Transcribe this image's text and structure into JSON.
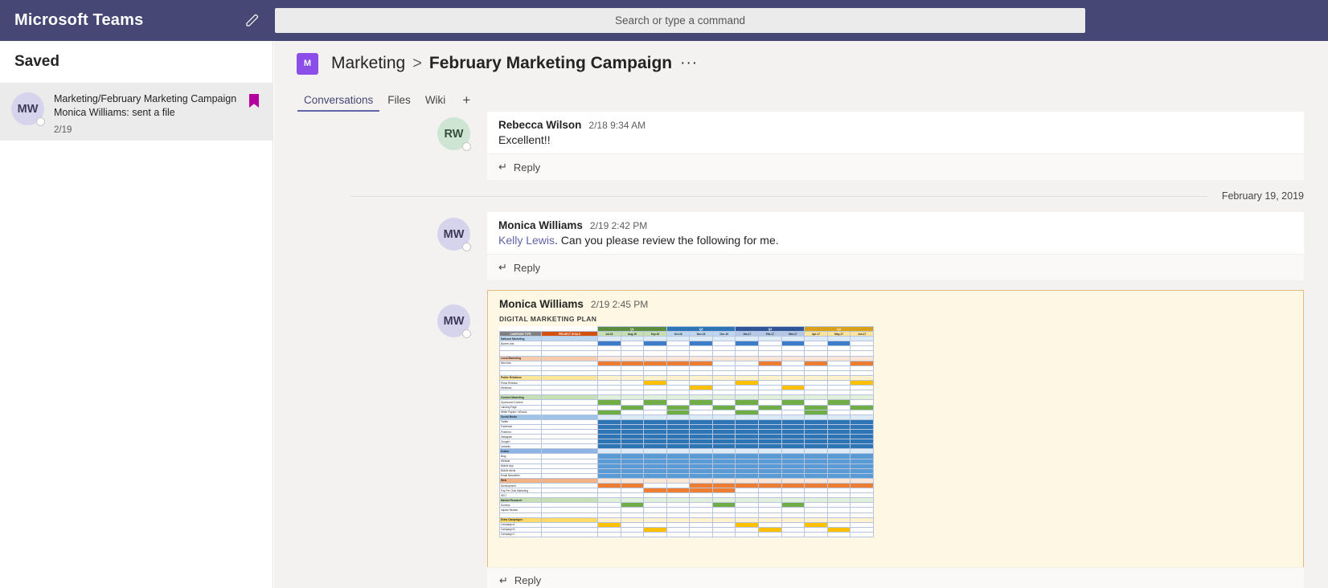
{
  "app": {
    "title": "Microsoft Teams",
    "compose_icon": "compose-icon",
    "search_placeholder": "Search or type a command",
    "accent": "#464775",
    "brand_purple": "#6264a7"
  },
  "sidebar": {
    "header": "Saved",
    "items": [
      {
        "avatar_initials": "MW",
        "line1": "Marketing/February Marketing Campaign",
        "line2": "Monica Williams: sent a file",
        "date": "2/19",
        "bookmark_icon": "bookmark-icon",
        "bookmark_color": "#b4009e"
      }
    ]
  },
  "channel": {
    "badge_initial": "M",
    "team": "Marketing",
    "separator": ">",
    "name": "February Marketing Campaign",
    "more": "···",
    "tabs": [
      {
        "label": "Conversations",
        "active": true
      },
      {
        "label": "Files",
        "active": false
      },
      {
        "label": "Wiki",
        "active": false
      }
    ],
    "add_tab": "+"
  },
  "conversation": {
    "reply_label": "Reply",
    "reply_icon": "reply-arrow-icon",
    "day_separator": "February 19, 2019",
    "messages": [
      {
        "avatar_initials": "RW",
        "author": "Rebecca Wilson",
        "time": "2/18 9:34 AM",
        "text": "Excellent!!"
      },
      {
        "avatar_initials": "MW",
        "author": "Monica Williams",
        "time": "2/19 2:42 PM",
        "mention": "Kelly Lewis",
        "text": ". Can you please review the following for me."
      },
      {
        "avatar_initials": "MW",
        "author": "Monica Williams",
        "time": "2/19 2:45 PM",
        "attachment_title": "DIGITAL MARKETING PLAN"
      }
    ]
  },
  "chart_data": {
    "type": "table",
    "title": "DIGITAL MARKETING PLAN",
    "columns": [
      "CAMPAIGN TYPE",
      "PROJECT GOALS"
    ],
    "quarters": [
      {
        "label": "Q1",
        "color": "#5b8c3e",
        "months": [
          "Jul-16",
          "Aug-16",
          "Sep-16"
        ]
      },
      {
        "label": "Q2",
        "color": "#2e75b6",
        "months": [
          "Oct-16",
          "Nov-16",
          "Dec-16"
        ]
      },
      {
        "label": "Q3",
        "color": "#2f5597",
        "months": [
          "Jan-17",
          "Feb-17",
          "Mar-17"
        ]
      },
      {
        "label": "Q4",
        "color": "#d9a01a",
        "months": [
          "Apr-17",
          "May-17",
          "Jun-17"
        ]
      }
    ],
    "sections": [
      {
        "name": "National Marketing",
        "style": "sec-blue",
        "tint": "tint-blue",
        "rows": [
          {
            "label": "Banner Ads",
            "fill": "f-blue",
            "cells": [
              1,
              0,
              1,
              0,
              1,
              0,
              1,
              0,
              1,
              0,
              1,
              0
            ]
          },
          {
            "label": "",
            "fill": "f-none",
            "cells": [
              0,
              0,
              0,
              0,
              0,
              0,
              0,
              0,
              0,
              0,
              0,
              0
            ]
          },
          {
            "label": "",
            "fill": "f-none",
            "cells": [
              0,
              0,
              0,
              0,
              0,
              0,
              0,
              0,
              0,
              0,
              0,
              0
            ]
          }
        ]
      },
      {
        "name": "Local Marketing",
        "style": "sec-peach",
        "tint": "tint-peach",
        "rows": [
          {
            "label": "New Ads",
            "fill": "f-orange",
            "cells": [
              1,
              1,
              1,
              1,
              1,
              0,
              0,
              1,
              0,
              1,
              0,
              1
            ]
          },
          {
            "label": "",
            "fill": "f-none",
            "cells": [
              0,
              0,
              0,
              0,
              0,
              0,
              0,
              0,
              0,
              0,
              0,
              0
            ]
          },
          {
            "label": "",
            "fill": "f-none",
            "cells": [
              0,
              0,
              0,
              0,
              0,
              0,
              0,
              0,
              0,
              0,
              0,
              0
            ]
          }
        ]
      },
      {
        "name": "Public Relations",
        "style": "sec-yellow",
        "tint": "tint-yellow",
        "rows": [
          {
            "label": "Press Release",
            "fill": "f-gold",
            "cells": [
              0,
              0,
              1,
              0,
              0,
              0,
              1,
              0,
              0,
              0,
              0,
              1
            ]
          },
          {
            "label": "Webinars",
            "fill": "f-gold",
            "cells": [
              0,
              0,
              0,
              0,
              1,
              0,
              0,
              0,
              1,
              0,
              0,
              0
            ]
          },
          {
            "label": "",
            "fill": "f-none",
            "cells": [
              0,
              0,
              0,
              0,
              0,
              0,
              0,
              0,
              0,
              0,
              0,
              0
            ]
          }
        ]
      },
      {
        "name": "Content Marketing",
        "style": "sec-green",
        "tint": "tint-green",
        "rows": [
          {
            "label": "Sponsored Content",
            "fill": "f-green",
            "cells": [
              1,
              0,
              1,
              0,
              1,
              0,
              1,
              0,
              1,
              0,
              1,
              0
            ]
          },
          {
            "label": "Landing Page",
            "fill": "f-green",
            "cells": [
              0,
              1,
              0,
              1,
              0,
              1,
              0,
              1,
              0,
              1,
              0,
              1
            ]
          },
          {
            "label": "White Papers / eBooks",
            "fill": "f-green",
            "cells": [
              1,
              0,
              0,
              1,
              0,
              0,
              1,
              0,
              0,
              1,
              0,
              0
            ]
          }
        ]
      },
      {
        "name": "Social Media",
        "style": "sec-blue2",
        "tint": "tint-blue",
        "rows": [
          {
            "label": "Twitter",
            "fill": "f-dkblue",
            "cells": [
              1,
              1,
              1,
              1,
              1,
              1,
              1,
              1,
              1,
              1,
              1,
              1
            ]
          },
          {
            "label": "Facebook",
            "fill": "f-dkblue",
            "cells": [
              1,
              1,
              1,
              1,
              1,
              1,
              1,
              1,
              1,
              1,
              1,
              1
            ]
          },
          {
            "label": "Pinterest",
            "fill": "f-dkblue",
            "cells": [
              1,
              1,
              1,
              1,
              1,
              1,
              1,
              1,
              1,
              1,
              1,
              1
            ]
          },
          {
            "label": "Instagram",
            "fill": "f-dkblue",
            "cells": [
              1,
              1,
              1,
              1,
              1,
              1,
              1,
              1,
              1,
              1,
              1,
              1
            ]
          },
          {
            "label": "Google+",
            "fill": "f-dkblue",
            "cells": [
              1,
              1,
              1,
              1,
              1,
              1,
              1,
              1,
              1,
              1,
              1,
              1
            ]
          },
          {
            "label": "LinkedIn",
            "fill": "f-dkblue",
            "cells": [
              1,
              1,
              1,
              1,
              1,
              1,
              1,
              1,
              1,
              1,
              1,
              1
            ]
          }
        ]
      },
      {
        "name": "Online",
        "style": "sec-dkblue",
        "tint": "tint-blue",
        "rows": [
          {
            "label": "Blog",
            "fill": "f-ltblue",
            "cells": [
              1,
              1,
              1,
              1,
              1,
              1,
              1,
              1,
              1,
              1,
              1,
              1
            ]
          },
          {
            "label": "Website",
            "fill": "f-ltblue",
            "cells": [
              1,
              1,
              1,
              1,
              1,
              1,
              1,
              1,
              1,
              1,
              1,
              1
            ]
          },
          {
            "label": "Mobile App",
            "fill": "f-ltblue",
            "cells": [
              1,
              1,
              1,
              1,
              1,
              1,
              1,
              1,
              1,
              1,
              1,
              1
            ]
          },
          {
            "label": "Mobile Alerts",
            "fill": "f-ltblue",
            "cells": [
              1,
              1,
              1,
              1,
              1,
              1,
              1,
              1,
              1,
              1,
              1,
              1
            ]
          },
          {
            "label": "Email Newsletter",
            "fill": "f-ltblue",
            "cells": [
              1,
              1,
              1,
              1,
              1,
              1,
              1,
              1,
              1,
              1,
              1,
              1
            ]
          }
        ]
      },
      {
        "name": "Web",
        "style": "sec-orange",
        "tint": "tint-peach",
        "rows": [
          {
            "label": "Development",
            "fill": "f-orange",
            "cells": [
              1,
              1,
              0,
              0,
              1,
              1,
              1,
              1,
              1,
              1,
              1,
              1
            ]
          },
          {
            "label": "Pay Per Click Marketing",
            "fill": "f-orange",
            "cells": [
              0,
              0,
              1,
              1,
              1,
              1,
              0,
              0,
              0,
              0,
              0,
              0
            ]
          },
          {
            "label": "SEO",
            "fill": "f-orange",
            "cells": [
              0,
              0,
              0,
              0,
              0,
              0,
              0,
              0,
              0,
              0,
              0,
              0
            ]
          }
        ]
      },
      {
        "name": "Market Research",
        "style": "sec-green2",
        "tint": "tint-green",
        "rows": [
          {
            "label": "Surveys",
            "fill": "f-green",
            "cells": [
              0,
              1,
              0,
              0,
              0,
              1,
              0,
              0,
              1,
              0,
              0,
              0
            ]
          },
          {
            "label": "Impact Studies",
            "fill": "f-green",
            "cells": [
              0,
              0,
              0,
              0,
              0,
              0,
              0,
              0,
              0,
              0,
              0,
              0
            ]
          },
          {
            "label": "",
            "fill": "f-none",
            "cells": [
              0,
              0,
              0,
              0,
              0,
              0,
              0,
              0,
              0,
              0,
              0,
              0
            ]
          }
        ]
      },
      {
        "name": "Extra Campaigns",
        "style": "sec-gold",
        "tint": "tint-gold",
        "rows": [
          {
            "label": "Campaign A",
            "fill": "f-gold",
            "cells": [
              1,
              0,
              0,
              0,
              0,
              0,
              1,
              0,
              0,
              1,
              0,
              0
            ]
          },
          {
            "label": "Campaign B",
            "fill": "f-gold",
            "cells": [
              0,
              0,
              1,
              0,
              0,
              0,
              0,
              1,
              0,
              0,
              1,
              0
            ]
          },
          {
            "label": "Campaign C",
            "fill": "f-gold",
            "cells": [
              0,
              0,
              0,
              0,
              0,
              0,
              0,
              0,
              0,
              0,
              0,
              0
            ]
          }
        ]
      }
    ]
  }
}
